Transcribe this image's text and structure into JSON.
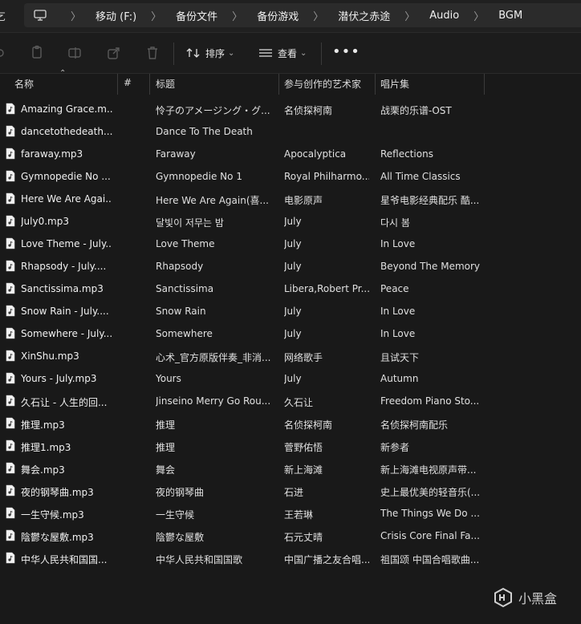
{
  "address_bar": {
    "left_fragment": "乞",
    "breadcrumbs": [
      "移动 (F:)",
      "备份文件",
      "备份游戏",
      "潜伏之赤途",
      "Audio",
      "BGM"
    ]
  },
  "toolbar": {
    "sort_label": "排序",
    "view_label": "查看",
    "more_label": "•••"
  },
  "columns": {
    "name": "名称",
    "number": "#",
    "title": "标题",
    "artists": "参与创作的艺术家",
    "album": "唱片集"
  },
  "files": [
    {
      "name": "Amazing Grace.m...",
      "title": "怜子のアメージング・グ...",
      "artist": "名侦探柯南",
      "album": "战栗的乐谱-OST"
    },
    {
      "name": "dancetothedeath....",
      "title": "Dance To The Death",
      "artist": "",
      "album": ""
    },
    {
      "name": "faraway.mp3",
      "title": "Faraway",
      "artist": "Apocalyptica",
      "album": "Reflections"
    },
    {
      "name": "Gymnopedie No ...",
      "title": "Gymnopedie No 1",
      "artist": "Royal Philharmo...",
      "album": "All Time Classics"
    },
    {
      "name": "Here We Are Agai...",
      "title": "Here We Are Again(喜...",
      "artist": "电影原声",
      "album": "星爷电影经典配乐 酷..."
    },
    {
      "name": "July0.mp3",
      "title": "달빛이 저무는 밤",
      "artist": "July",
      "album": "다시 봄"
    },
    {
      "name": "Love Theme - July...",
      "title": "Love Theme",
      "artist": "July",
      "album": "In Love"
    },
    {
      "name": "Rhapsody - July....",
      "title": "Rhapsody",
      "artist": "July",
      "album": "Beyond The Memory"
    },
    {
      "name": "Sanctissima.mp3",
      "title": "Sanctissima",
      "artist": "Libera,Robert Pr...",
      "album": "Peace"
    },
    {
      "name": "Snow Rain - July....",
      "title": "Snow Rain",
      "artist": "July",
      "album": "In Love"
    },
    {
      "name": "Somewhere - July....",
      "title": "Somewhere",
      "artist": "July",
      "album": "In Love"
    },
    {
      "name": "XinShu.mp3",
      "title": "心术_官方原版伴奏_非消...",
      "artist": "网络歌手",
      "album": "且试天下"
    },
    {
      "name": "Yours - July.mp3",
      "title": "Yours",
      "artist": "July",
      "album": "Autumn"
    },
    {
      "name": "久石让 - 人生的回...",
      "title": "Jinseino Merry Go Rou...",
      "artist": "久石让",
      "album": "Freedom Piano Sto..."
    },
    {
      "name": "推理.mp3",
      "title": "推理",
      "artist": "名侦探柯南",
      "album": "名侦探柯南配乐"
    },
    {
      "name": "推理1.mp3",
      "title": "推理",
      "artist": "菅野佑悟",
      "album": "新参者"
    },
    {
      "name": "舞会.mp3",
      "title": "舞会",
      "artist": "新上海滩",
      "album": "新上海滩电视原声带..."
    },
    {
      "name": "夜的钢琴曲.mp3",
      "title": "夜的钢琴曲",
      "artist": "石进",
      "album": "史上最优美的轻音乐(..."
    },
    {
      "name": "一生守候.mp3",
      "title": "一生守候",
      "artist": "王若琳",
      "album": "The Things We Do ..."
    },
    {
      "name": "陰鬱な屋敷.mp3",
      "title": "陰鬱な屋敷",
      "artist": "石元丈晴",
      "album": "Crisis Core Final Fa..."
    },
    {
      "name": "中华人民共和国国...",
      "title": "中华人民共和国国歌",
      "artist": "中国广播之友合唱...",
      "album": "祖国颂 中国合唱歌曲..."
    }
  ],
  "watermark": {
    "text": "小黑盒"
  }
}
